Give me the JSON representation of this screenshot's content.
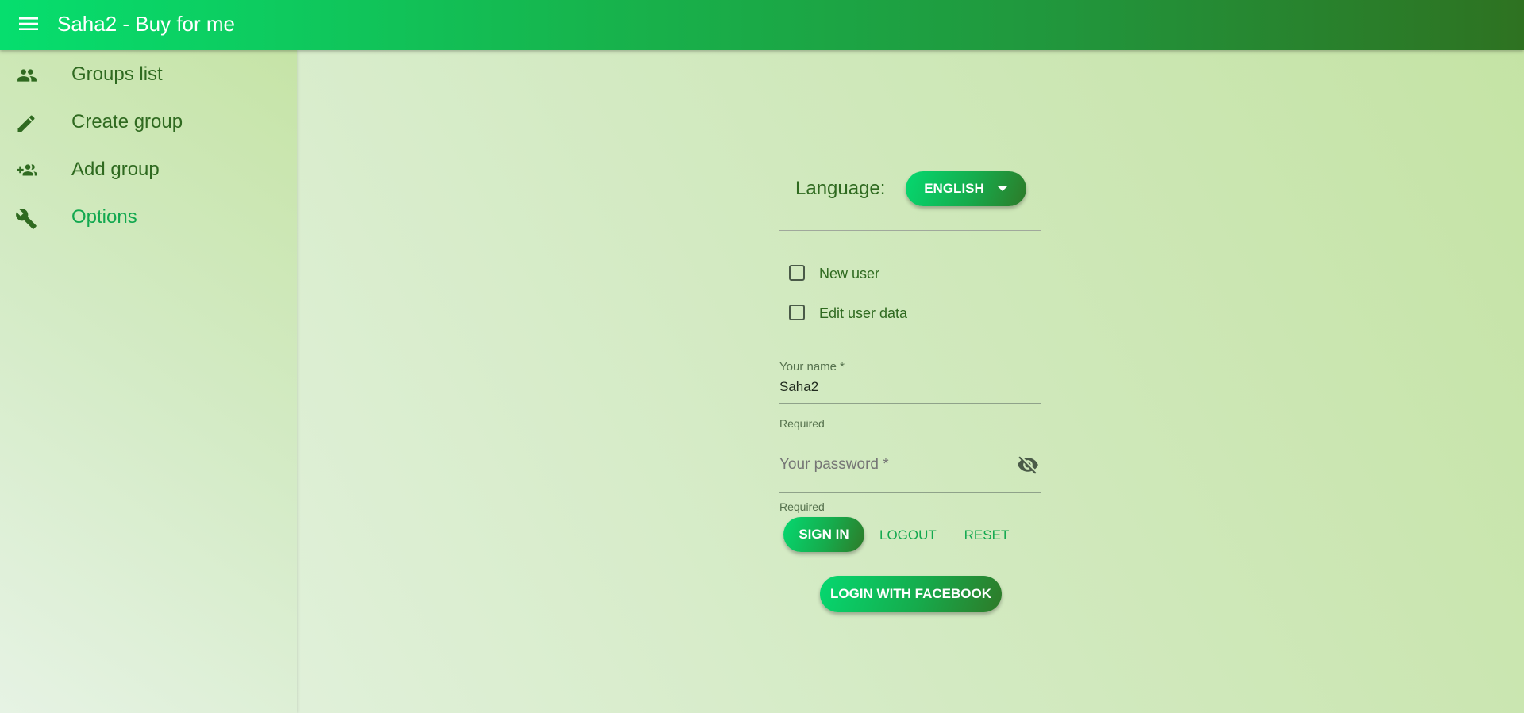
{
  "app": {
    "title": "Saha2 - Buy for me"
  },
  "sidebar": {
    "items": [
      {
        "label": "Groups list",
        "icon": "group-icon",
        "active": false
      },
      {
        "label": "Create group",
        "icon": "pencil-icon",
        "active": false
      },
      {
        "label": "Add group",
        "icon": "group-add-icon",
        "active": false
      },
      {
        "label": "Options",
        "icon": "wrench-icon",
        "active": true
      }
    ]
  },
  "language": {
    "label": "Language:",
    "selected": "ENGLISH"
  },
  "checkboxes": {
    "new_user": {
      "label": "New user",
      "checked": false
    },
    "edit_user_data": {
      "label": "Edit user data",
      "checked": false
    }
  },
  "form": {
    "name": {
      "label": "Your name *",
      "value": "Saha2",
      "helper": "Required"
    },
    "password": {
      "placeholder": "Your password *",
      "value": "",
      "helper": "Required"
    }
  },
  "actions": {
    "sign_in": "SIGN IN",
    "logout": "LOGOUT",
    "reset": "RESET",
    "facebook": "LOGIN WITH FACEBOOK"
  },
  "colors": {
    "brand_green": "#12a84f",
    "nav_text": "#2f6a20",
    "appbar_start": "#06de6e",
    "appbar_end": "#2e7221"
  }
}
